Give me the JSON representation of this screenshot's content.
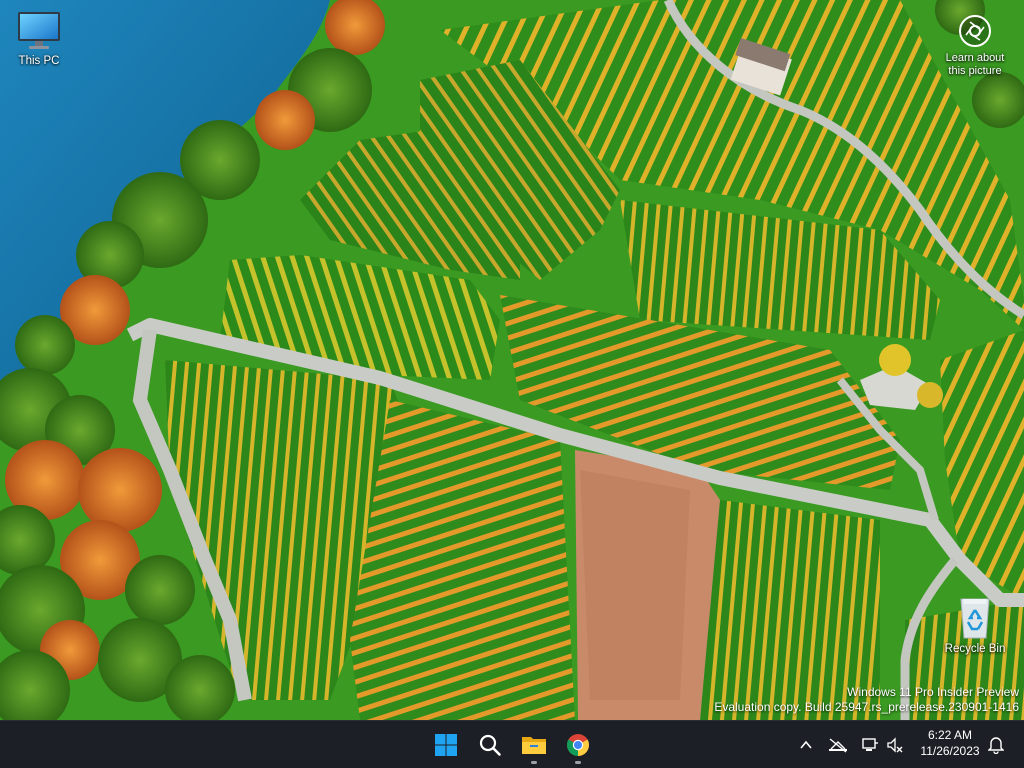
{
  "desktop": {
    "icons": [
      {
        "label": "This PC",
        "icon": "monitor-icon"
      },
      {
        "label": "Recycle Bin",
        "icon": "recycle-bin-icon"
      }
    ],
    "spotlight": {
      "label_line1": "Learn about",
      "label_line2": "this picture",
      "icon": "camera-icon"
    }
  },
  "watermark": {
    "line1": "Windows 11 Pro Insider Preview",
    "line2": "Evaluation copy. Build 25947.rs_prerelease.230901-1416"
  },
  "taskbar": {
    "apps": [
      {
        "name": "Start",
        "icon": "windows-logo-icon"
      },
      {
        "name": "Search",
        "icon": "search-icon"
      },
      {
        "name": "File Explorer",
        "icon": "folder-icon"
      },
      {
        "name": "Google Chrome",
        "icon": "chrome-icon"
      }
    ],
    "tray": {
      "time": "6:22 AM",
      "date": "11/26/2023",
      "icons": [
        "chevron-up-icon",
        "network-icon",
        "device-icon",
        "volume-muted-icon",
        "bell-icon"
      ]
    }
  },
  "colors": {
    "lake": "#1b7fb4",
    "vineyard_green": "#3f9a22",
    "autumn_orange": "#d9781e",
    "taskbar": "#1c2026",
    "windows_blue": "#1fa4f2"
  }
}
